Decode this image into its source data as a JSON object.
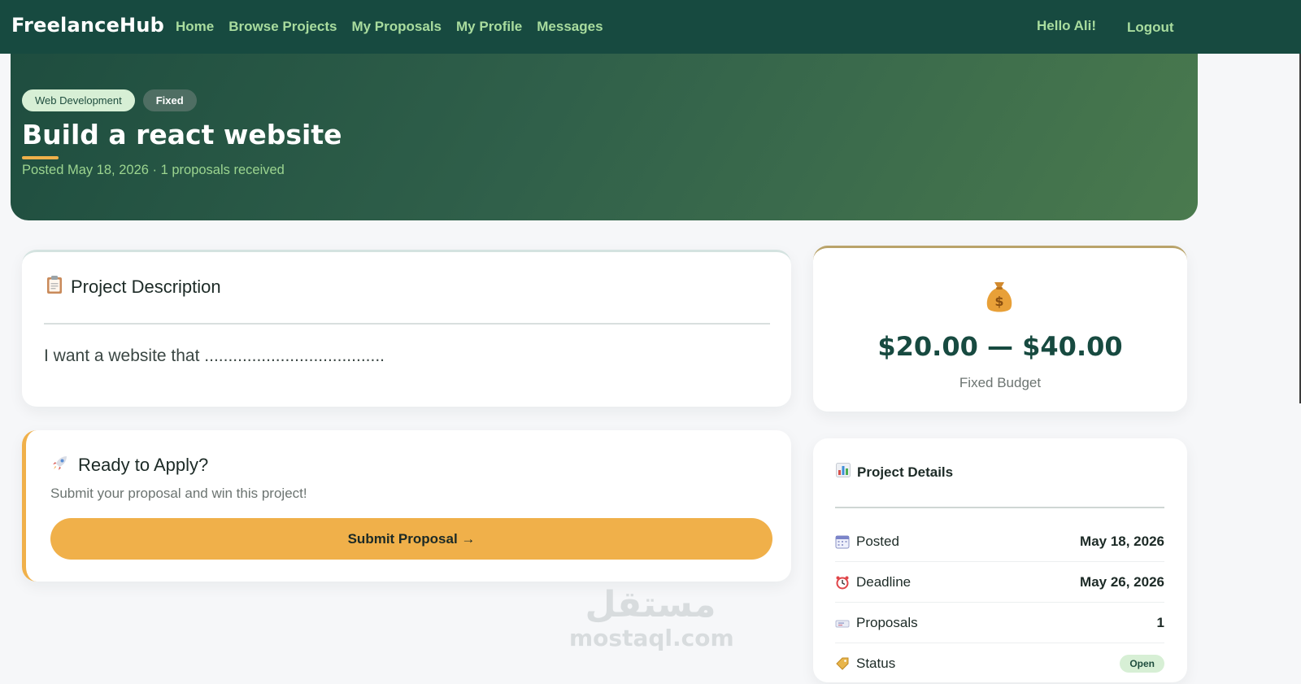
{
  "navbar": {
    "brand": "FreelanceHub",
    "links": [
      "Home",
      "Browse Projects",
      "My Proposals",
      "My Profile",
      "Messages"
    ],
    "greeting": "Hello Ali!",
    "logout": "Logout"
  },
  "hero": {
    "category_tag": "Web Development",
    "type_tag": "Fixed",
    "title": "Build a react website",
    "meta": "Posted May 18, 2026 · 1 proposals received"
  },
  "description": {
    "heading": "Project Description",
    "icon": "clipboard-icon",
    "text": "I want a website that ......................................"
  },
  "apply": {
    "heading": "Ready to Apply?",
    "icon": "rocket-icon",
    "subtitle": "Submit your proposal and win this project!",
    "button_label": "Submit Proposal →"
  },
  "budget": {
    "icon": "money-bag-icon",
    "amount": "$20.00 — $40.00",
    "label": "Fixed Budget"
  },
  "details": {
    "heading": "Project Details",
    "icon": "bar-chart-icon",
    "rows": [
      {
        "label": "Posted",
        "value": "May 18, 2026",
        "icon": "calendar-icon"
      },
      {
        "label": "Deadline",
        "value": "May 26, 2026",
        "icon": "alarm-clock-icon"
      },
      {
        "label": "Proposals",
        "value": "1",
        "icon": "ticket-icon"
      },
      {
        "label": "Status",
        "value": "Open",
        "icon": "tag-icon"
      }
    ]
  },
  "watermark": {
    "arabic": "مستقل",
    "latin": "mostaql.com"
  },
  "colors": {
    "nav_bg": "#174a40",
    "nav_link": "#a9dc9e",
    "accent": "#f0b04a",
    "budget_text": "#174a40"
  }
}
